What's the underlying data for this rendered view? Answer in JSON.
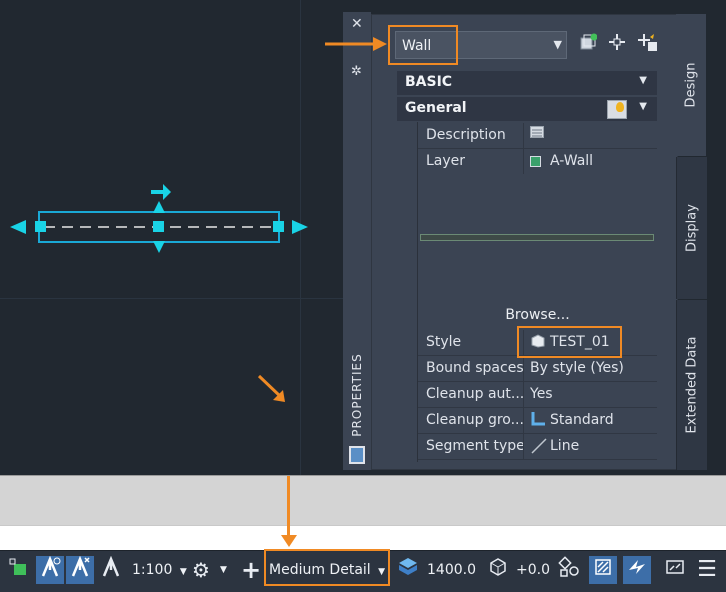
{
  "palette": {
    "object_type": "Wall",
    "tabs": [
      "Design",
      "Display",
      "Extended Data"
    ],
    "strip_title": "PROPERTIES",
    "sections": [
      {
        "label": "BASIC"
      },
      {
        "label": "General"
      }
    ],
    "rows_top": [
      {
        "key": "Description",
        "value": ""
      },
      {
        "key": "Layer",
        "value": "A-Wall"
      }
    ],
    "browse_label": "Browse...",
    "rows_bottom": [
      {
        "key": "Style",
        "value": "TEST_01"
      },
      {
        "key": "Bound spaces",
        "value": "By style (Yes)"
      },
      {
        "key": "Cleanup aut...",
        "value": "Yes"
      },
      {
        "key": "Cleanup gro...",
        "value": "Standard"
      },
      {
        "key": "Segment type",
        "value": "Line"
      }
    ]
  },
  "statusbar": {
    "scale": "1:100",
    "display_config": "Medium Detail",
    "cut_plane": "1400.0",
    "elevation": "+0.0"
  },
  "colors": {
    "highlight": "#f08a24",
    "grip": "#19d3e6",
    "canvas": "#212830",
    "layer_swatch": "#3aa06b"
  },
  "icons": {
    "close": "close-icon",
    "settings": "gear-icon",
    "quick_select": "quick-select-icon",
    "pick_object": "pick-object-icon",
    "toggle_pickadd": "pickadd-icon",
    "menu": "hamburger-menu-icon"
  }
}
